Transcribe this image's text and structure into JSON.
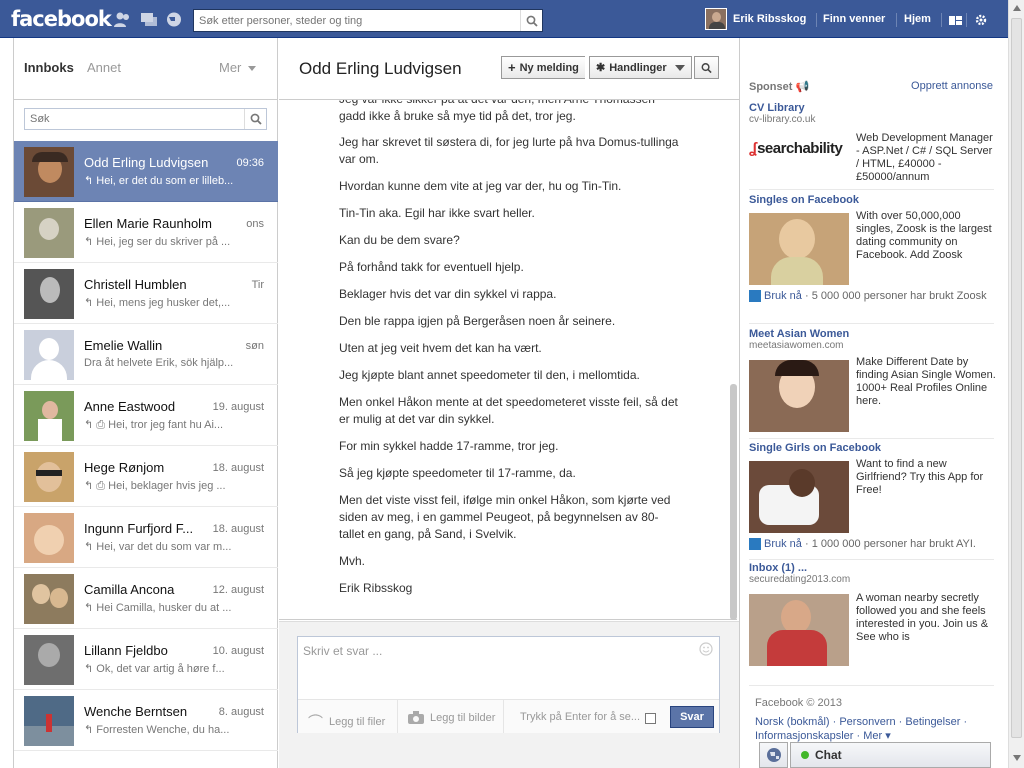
{
  "app": {
    "logo": "facebook"
  },
  "topbar": {
    "search_placeholder": "Søk etter personer, steder og ting",
    "user_name": "Erik Ribsskog",
    "find_friends": "Finn venner",
    "home": "Hjem"
  },
  "left": {
    "tab_inbox": "Innboks",
    "tab_other": "Annet",
    "more": "Mer",
    "search_placeholder": "Søk",
    "threads": [
      {
        "name": "Odd Erling Ludvigsen",
        "date": "09:36",
        "snippet": "Hei, er det du som er lilleb...",
        "avatar_color": "#6b4a36"
      },
      {
        "name": "Ellen Marie Raunholm",
        "date": "ons",
        "snippet": "Hei, jeg ser du skriver på ...",
        "avatar_color": "#9a9a7c"
      },
      {
        "name": "Christell Humblen",
        "date": "Tir",
        "snippet": "Hei, mens jeg husker det,...",
        "avatar_color": "#555555"
      },
      {
        "name": "Emelie Wallin",
        "date": "søn",
        "snippet": "Dra åt helvete Erik, sök hjälp...",
        "avatar_color": "#c9cfdc"
      },
      {
        "name": "Anne Eastwood",
        "date": "19. august",
        "snippet": "Hei, tror jeg fant hu Ai...",
        "avatar_color": "#7a9a5a"
      },
      {
        "name": "Hege Rønjom",
        "date": "18. august",
        "snippet": "Hei, beklager hvis jeg ...",
        "avatar_color": "#c9a36a"
      },
      {
        "name": "Ingunn Furfjord F...",
        "date": "18. august",
        "snippet": "Hei, var det du som var m...",
        "avatar_color": "#d8a883"
      },
      {
        "name": "Camilla Ancona",
        "date": "12. august",
        "snippet": "Hei Camilla, husker du at ...",
        "avatar_color": "#8d7b5e"
      },
      {
        "name": "Lillann Fjeldbo",
        "date": "10. august",
        "snippet": "Ok, det var artig å høre f...",
        "avatar_color": "#6e6e6e"
      },
      {
        "name": "Wenche Berntsen",
        "date": "8. august",
        "snippet": "Forresten Wenche, du ha...",
        "avatar_color": "#4f6a86"
      }
    ]
  },
  "conversation": {
    "title": "Odd Erling Ludvigsen",
    "new_message": "Ny melding",
    "actions": "Handlinger",
    "messages": [
      "Jeg var ikke sikker på at det var den, men Arne Thomassen gadd ikke å bruke så mye tid på det, tror jeg.",
      "Jeg har skrevet til søstera di, for jeg lurte på hva Domus-tullinga var om.",
      "Hvordan kunne dem vite at jeg var der, hu og Tin-Tin.",
      "Tin-Tin aka. Egil har ikke svart heller.",
      "Kan du be dem svare?",
      "På forhånd takk for eventuell hjelp.",
      "Beklager hvis det var din sykkel vi rappa.",
      "Den ble rappa igjen på Bergeråsen noen år seinere.",
      "Uten at jeg veit hvem det kan ha vært.",
      "Jeg kjøpte blant annet speedometer til den, i mellomtida.",
      "Men onkel Håkon mente at det speedometeret visste feil, så det er mulig at det var din sykkel.",
      "For min sykkel hadde 17-ramme, tror jeg.",
      "Så jeg kjøpte speedometer til 17-ramme, da.",
      "Men det viste visst feil, ifølge min onkel Håkon, som kjørte ved siden av meg, i en gammel Peugeot, på begynnelsen av 80-tallet en gang, på Sand, i Svelvik.",
      "Mvh.",
      "Erik Ribsskog"
    ]
  },
  "reply": {
    "placeholder": "Skriv et svar ...",
    "attach_files": "Legg til filer",
    "attach_images": "Legg til bilder",
    "enter_to_send": "Trykk på Enter for å se...",
    "send": "Svar"
  },
  "ads": {
    "sponsored": "Sponset",
    "create_ad": "Opprett annonse",
    "cv_title": "CV Library",
    "cv_url": "cv-library.co.uk",
    "cv_logo": "searchability",
    "cv_text": "Web Development Manager - ASP.Net / C# / SQL Server / HTML, £40000 - £50000/annum",
    "items": [
      {
        "title": "Singles on Facebook",
        "url": "",
        "text": "With over 50,000,000 singles, Zoosk is the largest dating community on Facebook. Add Zoosk",
        "img_color": "#c6a378",
        "bruk": "Bruk nå",
        "bruk_rest": " · 5 000 000 personer har brukt Zoosk"
      },
      {
        "title": "Meet Asian Women",
        "url": "meetasiawomen.com",
        "text": "Make Different Date by finding Asian Single Women. 1000+ Real Profiles Online here.",
        "img_color": "#8a6a55",
        "bruk": "",
        "bruk_rest": ""
      },
      {
        "title": "Single Girls on Facebook",
        "url": "",
        "text": "Want to find a new Girlfriend? Try this App for Free!",
        "img_color": "#6b4a3a",
        "bruk": "Bruk nå",
        "bruk_rest": " · 1 000 000 personer har brukt AYI."
      },
      {
        "title": "Inbox (1) ...",
        "url": "securedating2013.com",
        "text": "A woman nearby secretly followed you and she feels interested in you. Join us & See who is",
        "img_color": "#b04a4a",
        "bruk": "",
        "bruk_rest": ""
      }
    ]
  },
  "footer": {
    "copyright": "Facebook © 2013",
    "links": "Norsk (bokmål) · Personvern · Betingelser · Informasjonskapsler · Mer ▾"
  },
  "chat": {
    "label": "Chat"
  }
}
